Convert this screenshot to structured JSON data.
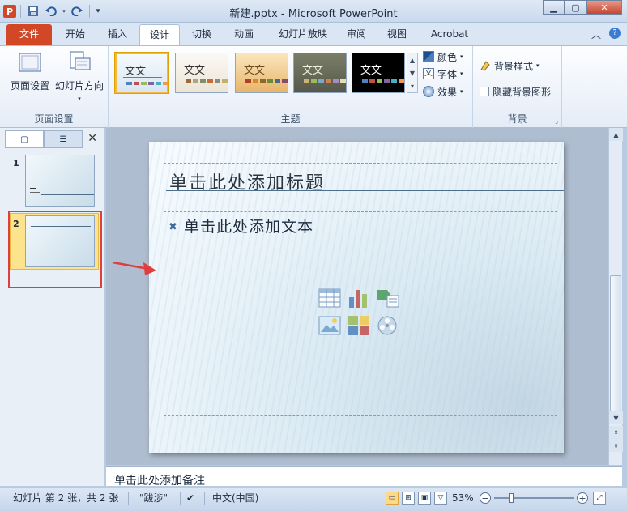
{
  "window": {
    "title": "新建.pptx - Microsoft PowerPoint",
    "app_logo": "P"
  },
  "quick_access": {
    "icons": [
      "save-icon",
      "undo-icon",
      "redo-icon",
      "customize-qat-icon"
    ]
  },
  "tabs": [
    {
      "label": "文件",
      "active": false,
      "file": true
    },
    {
      "label": "开始",
      "active": false
    },
    {
      "label": "插入",
      "active": false
    },
    {
      "label": "设计",
      "active": true
    },
    {
      "label": "切换",
      "active": false
    },
    {
      "label": "动画",
      "active": false
    },
    {
      "label": "幻灯片放映",
      "active": false
    },
    {
      "label": "审阅",
      "active": false
    },
    {
      "label": "视图",
      "active": false
    },
    {
      "label": "Acrobat",
      "active": false
    }
  ],
  "ribbon": {
    "page_setup": {
      "group_label": "页面设置",
      "page_setup_label": "页面设置",
      "orientation_label": "幻灯片方向"
    },
    "themes": {
      "group_label": "主题",
      "theme_text": "文文",
      "items": [
        {
          "text": "文文",
          "bg": "#eef4fb",
          "fg": "#333333",
          "selected": true
        },
        {
          "text": "文文",
          "bg": "#f8f5ee",
          "fg": "#333333",
          "selected": false
        },
        {
          "text": "文文",
          "bg": "#f3d9a6",
          "fg": "#6b4b1f",
          "selected": false
        },
        {
          "text": "文文",
          "bg": "#6d705c",
          "fg": "#f0f0e0",
          "selected": false
        },
        {
          "text": "文文",
          "bg": "#000000",
          "fg": "#ffffff",
          "selected": false
        }
      ],
      "colors_label": "颜色",
      "fonts_label": "字体",
      "effects_label": "效果"
    },
    "background": {
      "group_label": "背景",
      "styles_label": "背景样式",
      "hide_graphics_label": "隐藏背景图形"
    }
  },
  "slides_panel": {
    "slides": [
      {
        "number": "1",
        "selected": false
      },
      {
        "number": "2",
        "selected": true
      }
    ]
  },
  "slide": {
    "title_placeholder": "单击此处添加标题",
    "body_placeholder": "单击此处添加文本",
    "content_icons": [
      "insert-table-icon",
      "insert-chart-icon",
      "insert-smartart-icon",
      "insert-picture-icon",
      "insert-clipart-icon",
      "insert-media-icon"
    ]
  },
  "notes": {
    "placeholder": "单击此处添加备注"
  },
  "status_bar": {
    "slide_info": "幻灯片 第 2 张，共 2 张",
    "theme_name": "\"跋涉\"",
    "language": "中文(中国)",
    "zoom": "53%"
  },
  "colors": {
    "file_tab": "#d24726",
    "selection": "#fde38b",
    "annotation_red": "#e03d3d"
  }
}
